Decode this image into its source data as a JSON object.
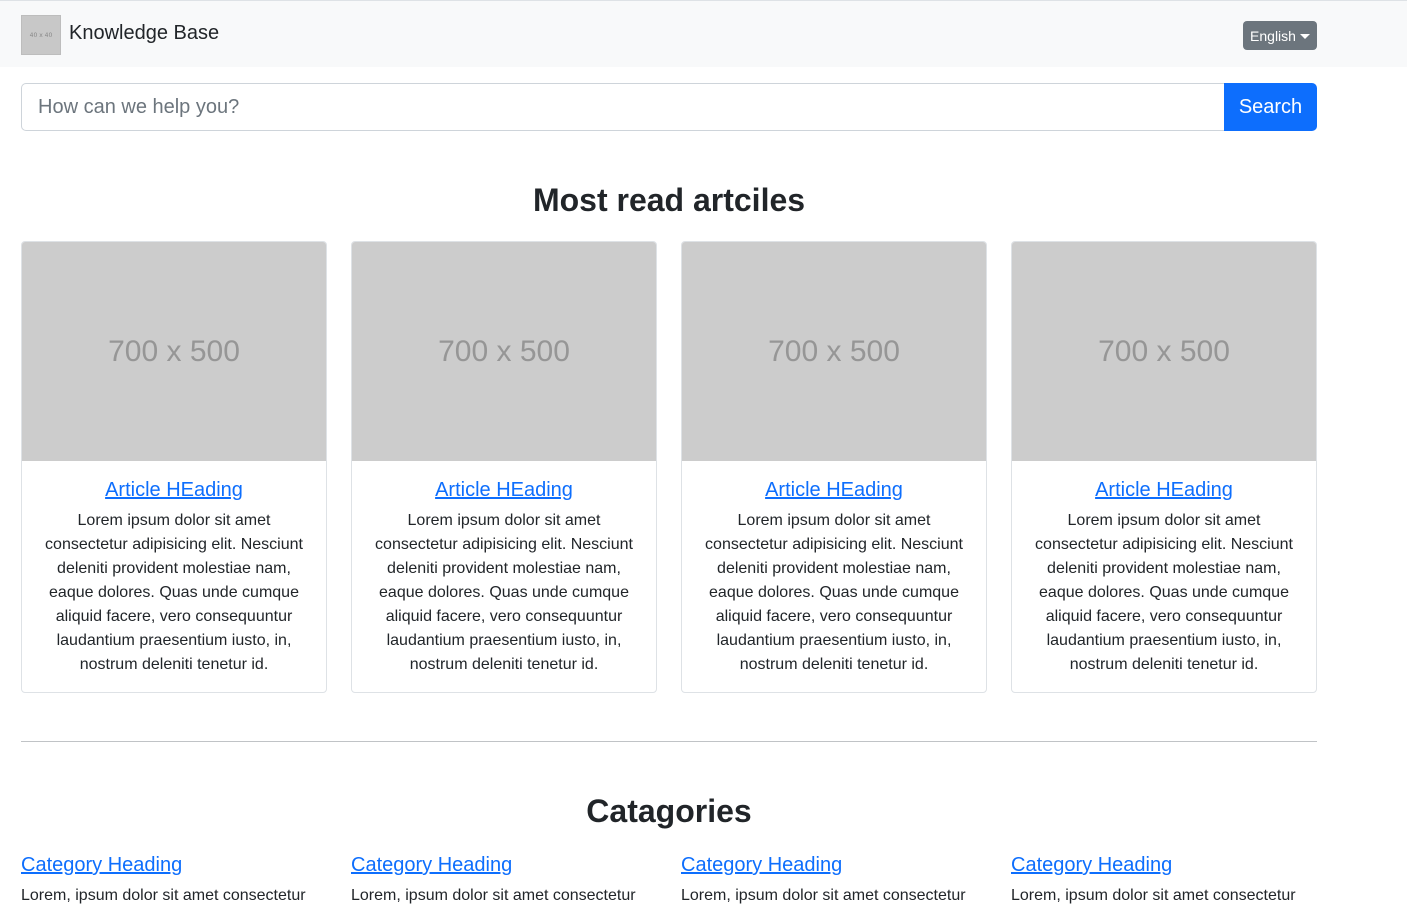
{
  "navbar": {
    "logo_text": "40 x 40",
    "brand": "Knowledge Base",
    "language": "English"
  },
  "search": {
    "placeholder": "How can we help you?",
    "button": "Search"
  },
  "most_read": {
    "title": "Most read artciles",
    "cards": [
      {
        "image_label": "700 x 500",
        "heading": "Article HEading",
        "text": "Lorem ipsum dolor sit amet consectetur adipisicing elit. Nesciunt deleniti provident molestiae nam, eaque dolores. Quas unde cumque aliquid facere, vero consequuntur laudantium praesentium iusto, in, nostrum deleniti tenetur id."
      },
      {
        "image_label": "700 x 500",
        "heading": "Article HEading",
        "text": "Lorem ipsum dolor sit amet consectetur adipisicing elit. Nesciunt deleniti provident molestiae nam, eaque dolores. Quas unde cumque aliquid facere, vero consequuntur laudantium praesentium iusto, in, nostrum deleniti tenetur id."
      },
      {
        "image_label": "700 x 500",
        "heading": "Article HEading",
        "text": "Lorem ipsum dolor sit amet consectetur adipisicing elit. Nesciunt deleniti provident molestiae nam, eaque dolores. Quas unde cumque aliquid facere, vero consequuntur laudantium praesentium iusto, in, nostrum deleniti tenetur id."
      },
      {
        "image_label": "700 x 500",
        "heading": "Article HEading",
        "text": "Lorem ipsum dolor sit amet consectetur adipisicing elit. Nesciunt deleniti provident molestiae nam, eaque dolores. Quas unde cumque aliquid facere, vero consequuntur laudantium praesentium iusto, in, nostrum deleniti tenetur id."
      }
    ]
  },
  "categories": {
    "title": "Catagories",
    "items": [
      {
        "heading": "Category Heading",
        "text": "Lorem, ipsum dolor sit amet consectetur"
      },
      {
        "heading": "Category Heading",
        "text": "Lorem, ipsum dolor sit amet consectetur"
      },
      {
        "heading": "Category Heading",
        "text": "Lorem, ipsum dolor sit amet consectetur"
      },
      {
        "heading": "Category Heading",
        "text": "Lorem, ipsum dolor sit amet consectetur"
      }
    ]
  },
  "colors": {
    "primary": "#0d6efd",
    "secondary": "#6c757d",
    "navbar_bg": "#f8f9fa",
    "placeholder_image": "#cccccc"
  }
}
